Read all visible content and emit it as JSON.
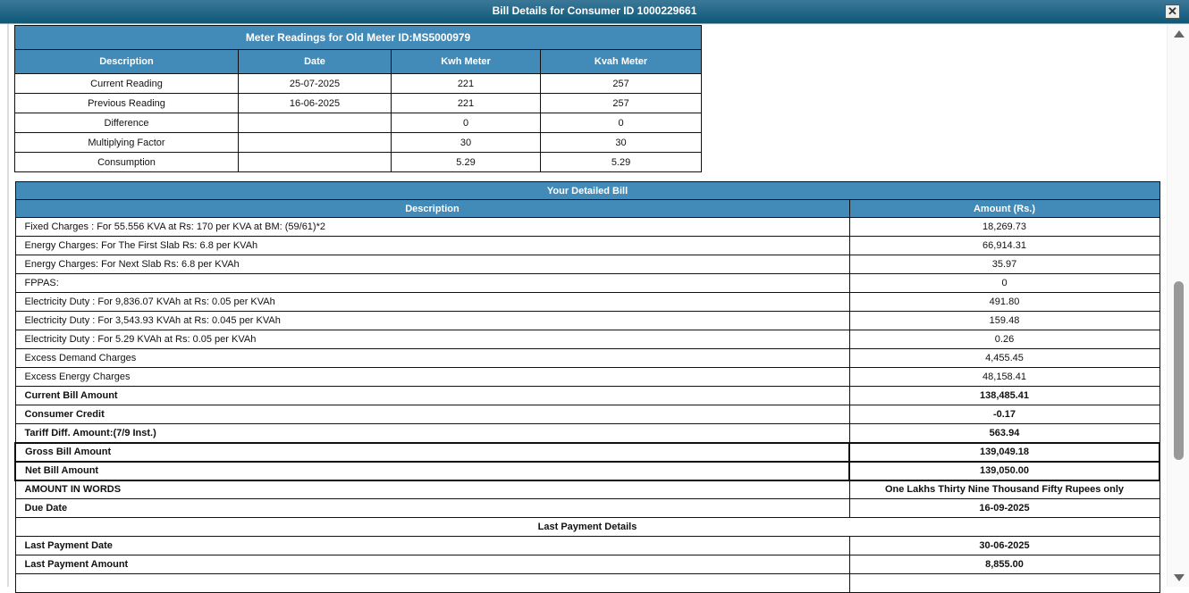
{
  "window": {
    "title": "Bill Details for Consumer ID 1000229661",
    "close_icon": "close-icon"
  },
  "meter": {
    "title": "Meter Readings for Old Meter ID:MS5000979",
    "headers": [
      "Description",
      "Date",
      "Kwh Meter",
      "Kvah Meter"
    ],
    "rows": [
      [
        "Current Reading",
        "25-07-2025",
        "221",
        "257"
      ],
      [
        "Previous Reading",
        "16-06-2025",
        "221",
        "257"
      ],
      [
        "Difference",
        "",
        "0",
        "0"
      ],
      [
        "Multiplying Factor",
        "",
        "30",
        "30"
      ],
      [
        "Consumption",
        "",
        "5.29",
        "5.29"
      ]
    ]
  },
  "bill": {
    "title": "Your Detailed Bill",
    "headers": [
      "Description",
      "Amount (Rs.)"
    ],
    "rows": [
      [
        "Fixed Charges : For 55.556 KVA at Rs: 170 per KVA at BM: (59/61)*2",
        "18,269.73"
      ],
      [
        "Energy Charges: For The First Slab Rs: 6.8 per KVAh",
        "66,914.31"
      ],
      [
        "Energy Charges: For Next Slab Rs: 6.8 per KVAh",
        "35.97"
      ],
      [
        "FPPAS:",
        "0"
      ],
      [
        "Electricity Duty : For 9,836.07 KVAh at Rs: 0.05 per KVAh",
        "491.80"
      ],
      [
        "Electricity Duty : For 3,543.93 KVAh at Rs: 0.045 per KVAh",
        "159.48"
      ],
      [
        "Electricity Duty : For 5.29 KVAh at Rs: 0.05 per KVAh",
        "0.26"
      ],
      [
        "Excess Demand Charges",
        "4,455.45"
      ],
      [
        "Excess Energy Charges",
        "48,158.41"
      ]
    ],
    "bold_rows": [
      [
        "Current Bill Amount",
        "138,485.41"
      ],
      [
        "Consumer Credit",
        "-0.17"
      ],
      [
        "Tariff Diff. Amount:(7/9 Inst.)",
        "563.94"
      ]
    ],
    "gross": [
      "Gross Bill Amount",
      "139,049.18"
    ],
    "net": [
      "Net Bill Amount",
      "139,050.00"
    ],
    "words": [
      "AMOUNT IN WORDS",
      "One Lakhs Thirty Nine Thousand Fifty Rupees only"
    ],
    "due": [
      "Due Date",
      "16-09-2025"
    ],
    "last_payment_title": "Last Payment Details",
    "last_payment": [
      [
        "Last Payment Date",
        "30-06-2025"
      ],
      [
        "Last Payment Amount",
        "8,855.00"
      ]
    ]
  }
}
